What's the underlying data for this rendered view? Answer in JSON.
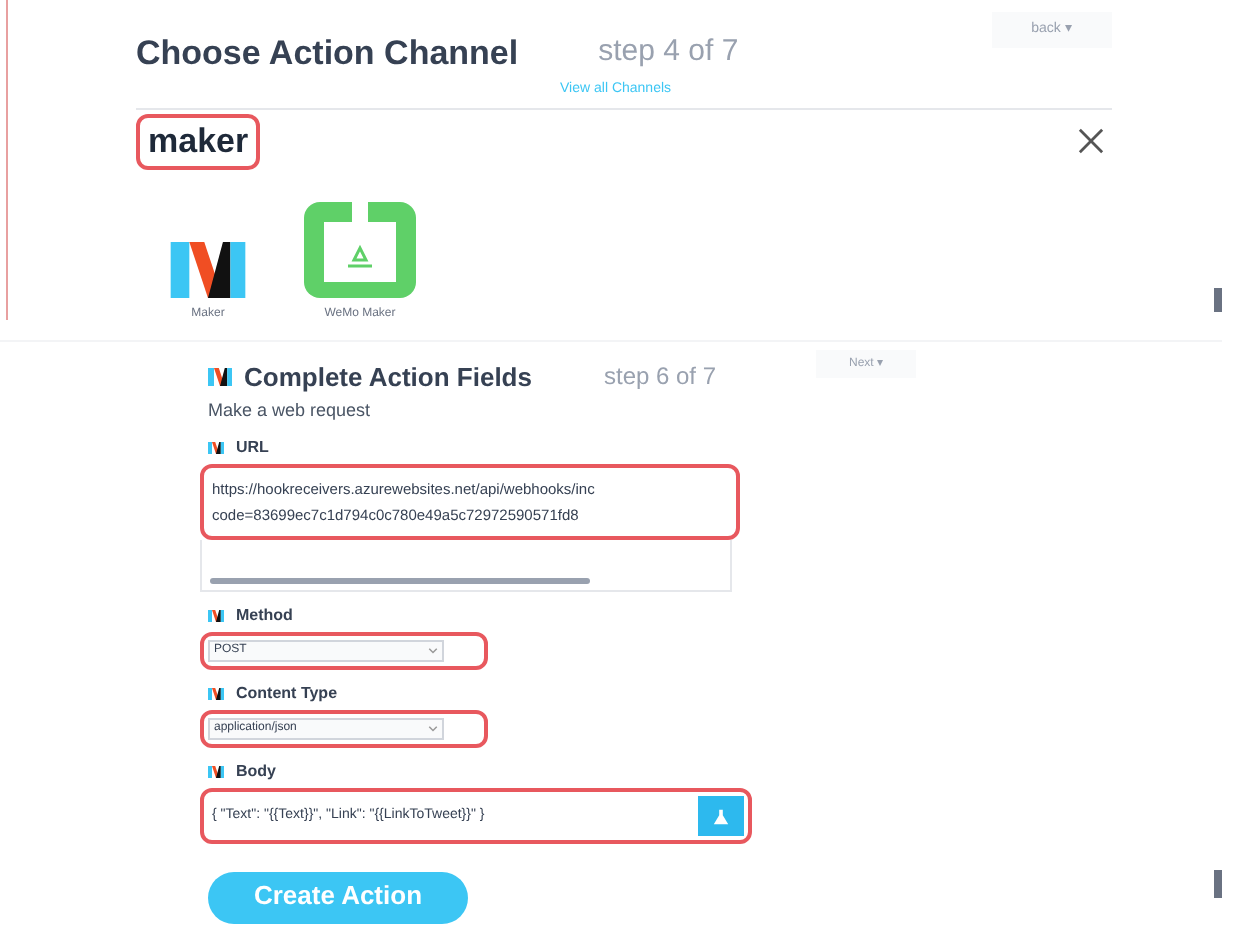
{
  "choose_panel": {
    "title": "Choose Action Channel",
    "step": "step 4 of 7",
    "back_button": "back ▾",
    "view_all_link": "View all Channels",
    "search": {
      "value": "maker",
      "highlighted": true
    },
    "channels": [
      {
        "name": "Maker",
        "kind": "maker"
      },
      {
        "name": "WeMo Maker",
        "kind": "wemo"
      }
    ]
  },
  "fields_panel": {
    "title": "Complete Action Fields",
    "step": "step 6 of 7",
    "next_button": "Next ▾",
    "subtitle": "Make a web request",
    "fields": [
      {
        "label": "URL",
        "kind": "textarea",
        "lines": [
          "https://hookreceivers.azurewebsites.net/api/webhooks/inc",
          "code=83699ec7c1d794c0c780e49a5c72972590571fd8"
        ],
        "highlighted": true
      },
      {
        "label": "Method",
        "kind": "select",
        "value": "POST",
        "highlighted": true
      },
      {
        "label": "Content Type",
        "kind": "select",
        "value": "application/json",
        "highlighted": true
      },
      {
        "label": "Body",
        "kind": "input",
        "value": "{ \"Text\": \"{{Text}}\", \"Link\": \"{{LinkToTweet}}\" }",
        "highlighted": true
      }
    ],
    "create_button": "Create Action"
  }
}
